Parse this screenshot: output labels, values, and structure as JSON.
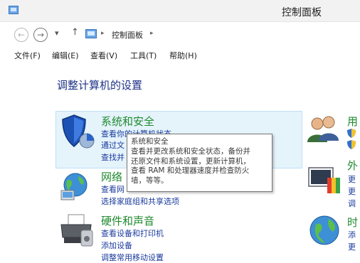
{
  "window": {
    "title": "控制面板"
  },
  "nav": {
    "back_glyph": "←",
    "forward_glyph": "→",
    "recent_glyph": "▾",
    "up_glyph": "↑",
    "separator": "▸",
    "breadcrumb": [
      "控制面板"
    ]
  },
  "menu": [
    "文件(F)",
    "编辑(E)",
    "查看(V)",
    "工具(T)",
    "帮助(H)"
  ],
  "main": {
    "heading": "调整计算机的设置",
    "categories": [
      {
        "title": "系统和安全",
        "links": [
          "查看你的计算机状态",
          "通过文",
          "查找并"
        ],
        "icon": "shield-icon"
      },
      {
        "title": "网络",
        "links": [
          "查看网",
          "选择家庭组和共享选项"
        ],
        "icon": "network-globe-icon"
      },
      {
        "title": "硬件和声音",
        "links": [
          "查看设备和打印机",
          "添加设备",
          "调整常用移动设置"
        ],
        "icon": "printer-icon"
      }
    ],
    "right_categories": [
      {
        "title": "用",
        "links": [
          "",
          ""
        ],
        "icon": "user-accounts-icon"
      },
      {
        "title": "外",
        "links": [
          "更",
          "更",
          "调"
        ],
        "icon": "appearance-icon"
      },
      {
        "title": "时",
        "links": [
          "添",
          "更"
        ],
        "icon": "clock-globe-icon"
      }
    ]
  },
  "tooltip": {
    "lines": [
      "系统和安全",
      "查看并更改系统和安全状态，备份并",
      "还原文件和系统设置，更新计算机，",
      "查看 RAM 和处理器速度并检查防火",
      "墙，等等。"
    ]
  }
}
